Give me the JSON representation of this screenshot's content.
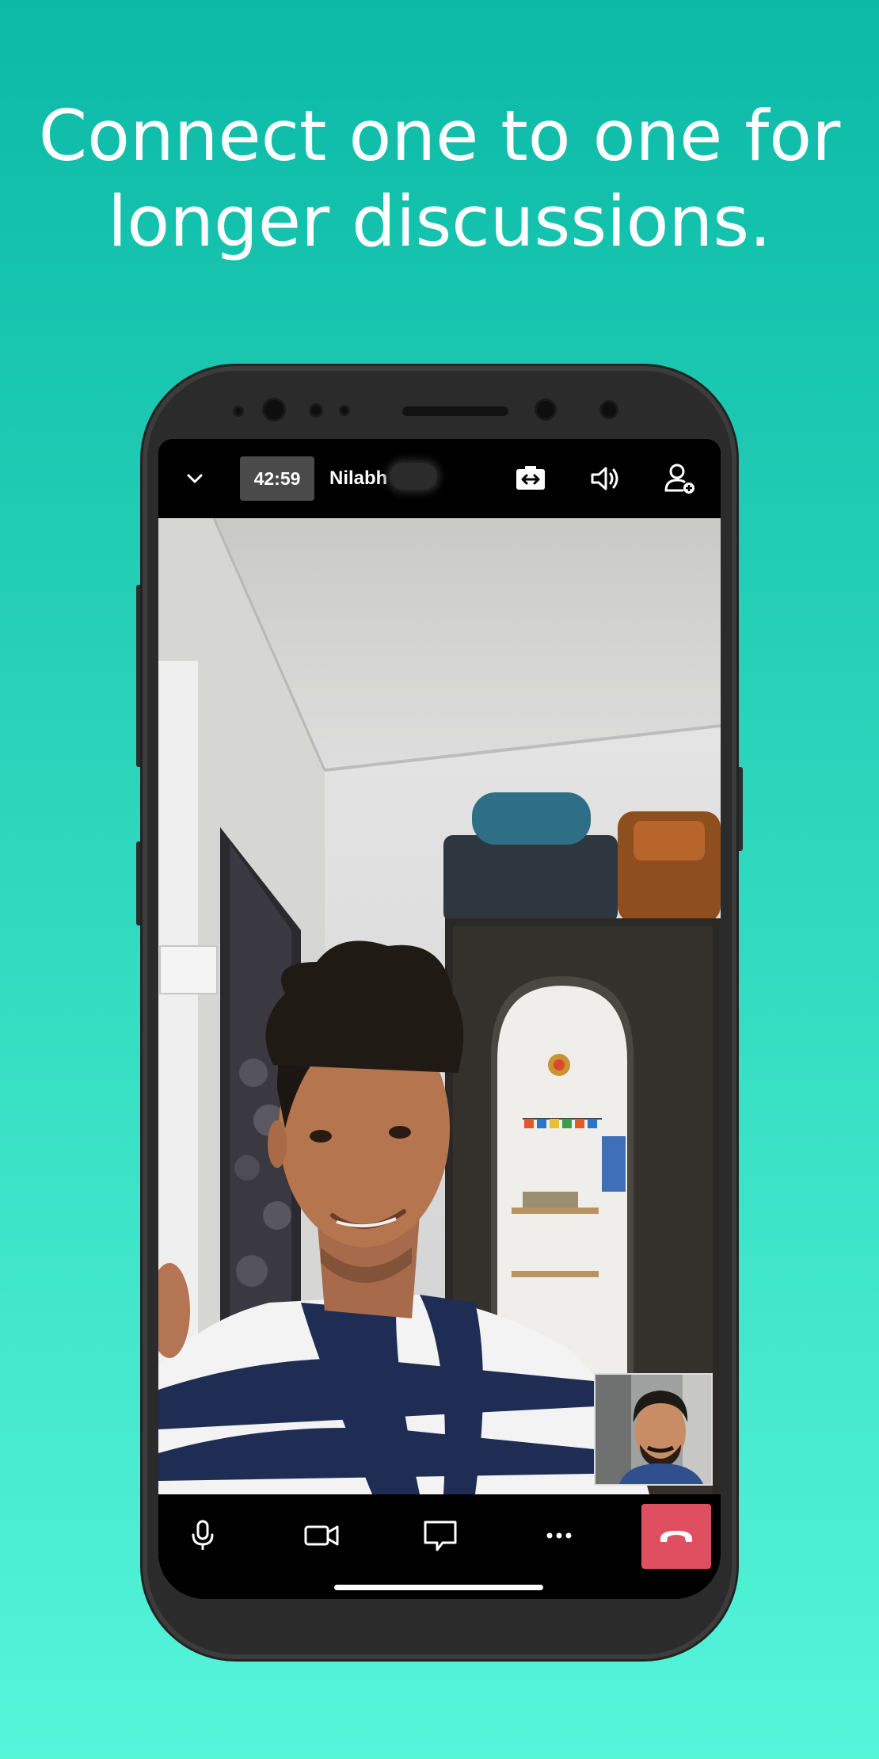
{
  "headline": {
    "line1": "Connect one to one for",
    "line2": "longer discussions."
  },
  "call": {
    "timer": "42:59",
    "participant_name": "Nilabh"
  },
  "icons": {
    "collapse": "chevron-down-icon",
    "switch_camera": "switch-camera-icon",
    "speaker": "speaker-volume-icon",
    "add_participant": "add-user-icon",
    "mic": "microphone-icon",
    "video": "video-camera-icon",
    "chat": "chat-icon",
    "more": "more-options-icon",
    "end_call": "end-call-icon"
  },
  "colors": {
    "background_top": "#0bb9a7",
    "background_bottom": "#55f5da",
    "end_call": "#e04f5f",
    "timer_bg": "#4a4a4a"
  }
}
